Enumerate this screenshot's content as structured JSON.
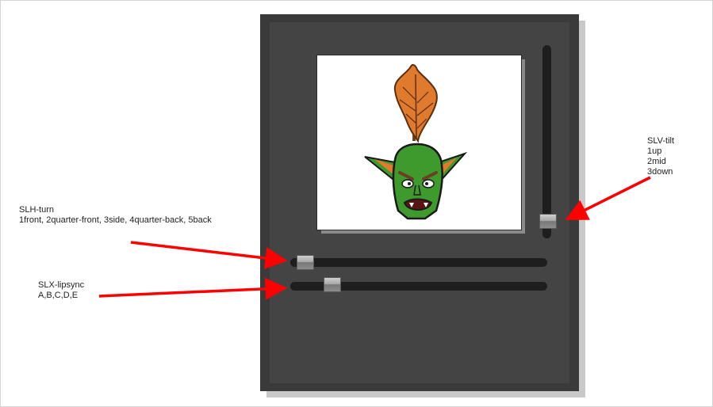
{
  "labels": {
    "slh_title": "SLH-turn",
    "slh_desc": "1front, 2quarter-front, 3side, 4quarter-back, 5back",
    "slx_title": "SLX-lipsync",
    "slx_desc": "A,B,C,D,E",
    "slv_title": "SLV-tilt",
    "slv_opt1": "1up",
    "slv_opt2": "2mid",
    "slv_opt3": "3down"
  },
  "colors": {
    "arrow": "#ff0000",
    "panel": "#3a3a3a",
    "track": "#1e1e1e",
    "goblin_skin": "#3f9a2e",
    "feather": "#e07a2c"
  },
  "icons": {
    "character": "goblin-head-icon"
  }
}
